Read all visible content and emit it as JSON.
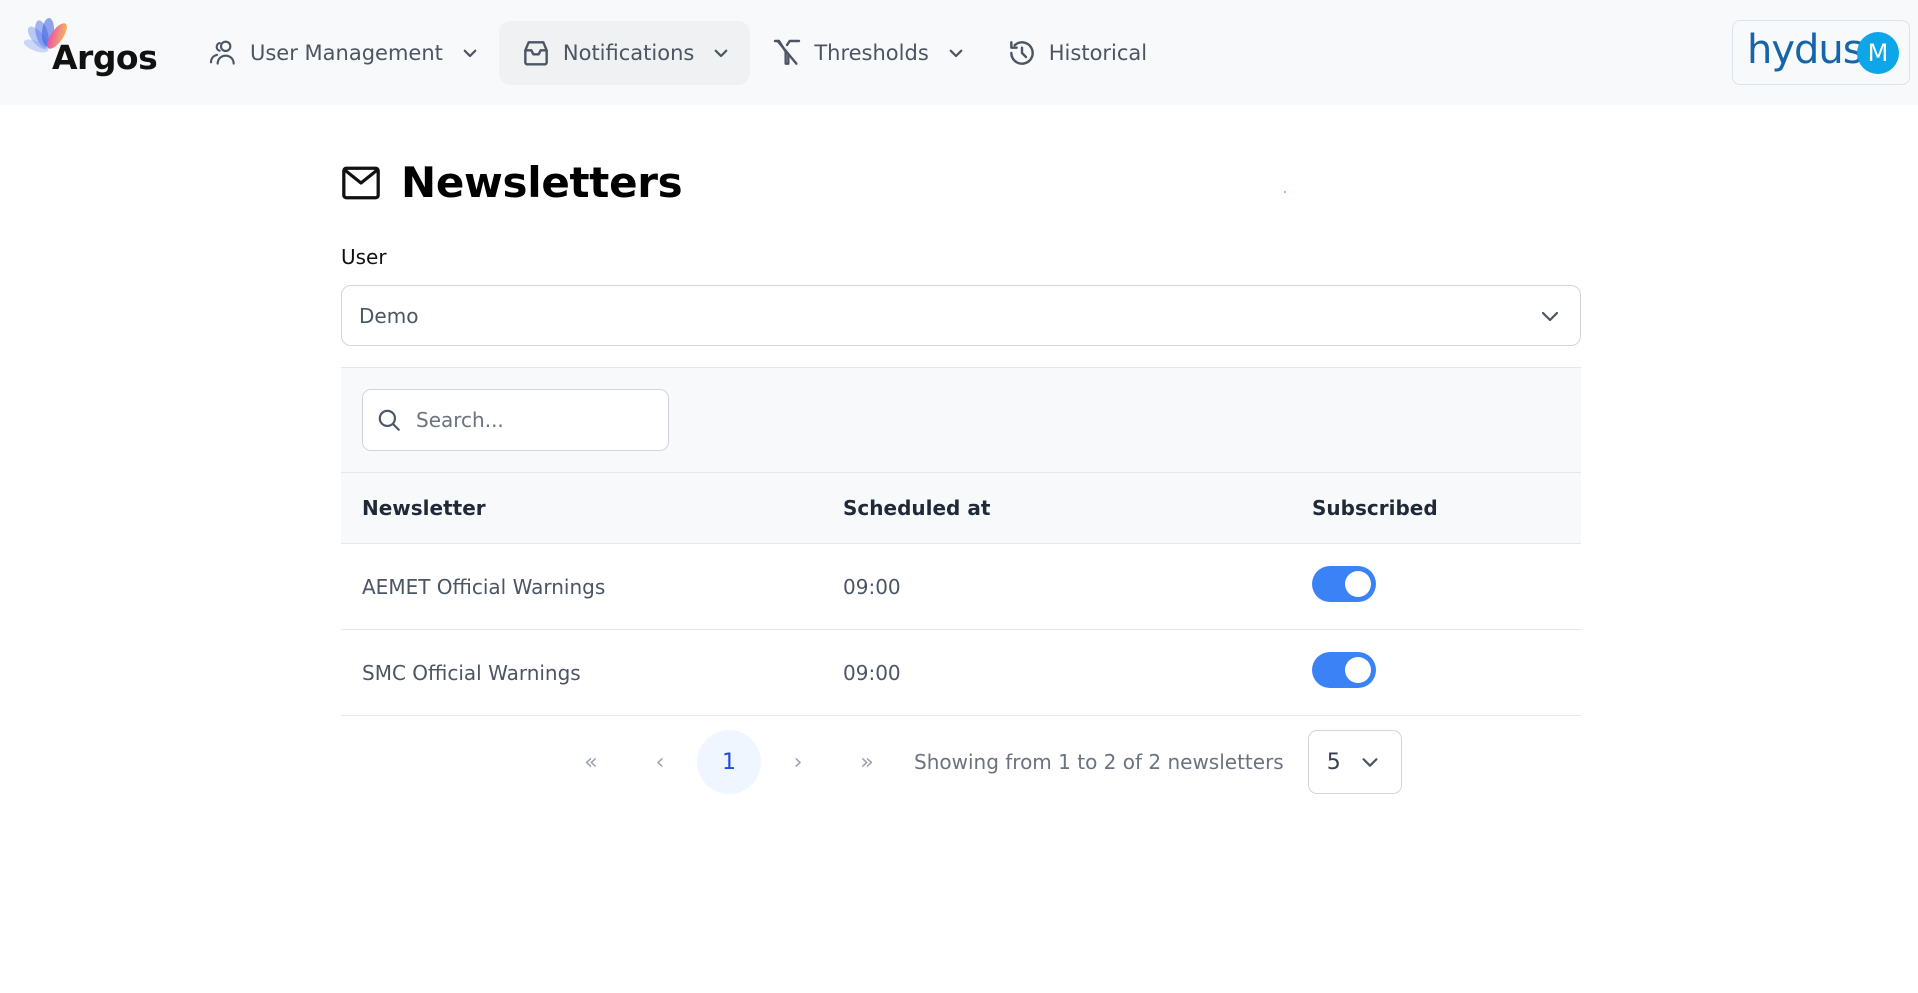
{
  "app": {
    "logo_text": "Argos",
    "partner_logo_text": "hydus",
    "avatar_initial": "M"
  },
  "nav": {
    "items": [
      {
        "label": "User Management",
        "icon": "users-icon",
        "has_dropdown": true,
        "active": false
      },
      {
        "label": "Notifications",
        "icon": "inbox-icon",
        "has_dropdown": true,
        "active": true
      },
      {
        "label": "Thresholds",
        "icon": "filter-off-icon",
        "has_dropdown": true,
        "active": false
      },
      {
        "label": "Historical",
        "icon": "history-icon",
        "has_dropdown": false,
        "active": false
      }
    ]
  },
  "page": {
    "title": "Newsletters",
    "title_icon": "mail-icon"
  },
  "user_select": {
    "label": "User",
    "value": "Demo"
  },
  "search": {
    "placeholder": "Search...",
    "value": ""
  },
  "table": {
    "columns": [
      "Newsletter",
      "Scheduled at",
      "Subscribed"
    ],
    "rows": [
      {
        "newsletter": "AEMET Official Warnings",
        "scheduled_at": "09:00",
        "subscribed": true
      },
      {
        "newsletter": "SMC Official Warnings",
        "scheduled_at": "09:00",
        "subscribed": true
      }
    ]
  },
  "pagination": {
    "first": "«",
    "prev": "‹",
    "current_page": "1",
    "next": "›",
    "last": "»",
    "info": "Showing from 1 to 2 of 2 newsletters",
    "page_size": "5"
  },
  "colors": {
    "accent": "#3b82f6",
    "avatar": "#0ea5e9",
    "partner_brand": "#1565a8",
    "current_page_bg": "#eff6ff"
  }
}
